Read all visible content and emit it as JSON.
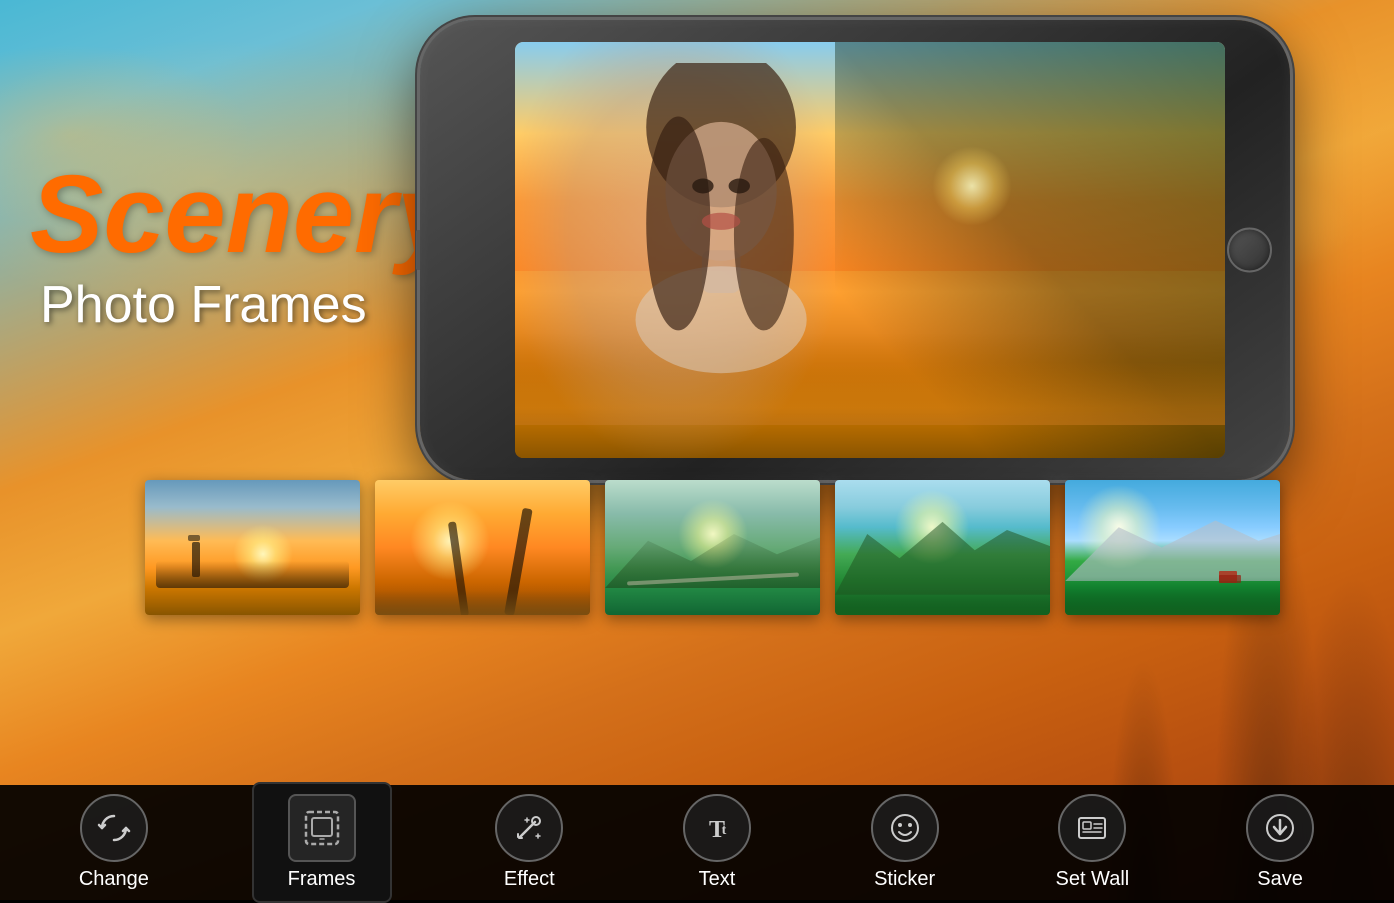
{
  "app": {
    "title": "Scenery Photo Frames"
  },
  "title": {
    "scenery": "Scenery",
    "subtitle": "Photo Frames"
  },
  "thumbnails": [
    {
      "id": 1,
      "label": "Lighthouse Sunset",
      "style": "thumb1"
    },
    {
      "id": 2,
      "label": "Palm Beach Sunset",
      "style": "thumb2"
    },
    {
      "id": 3,
      "label": "Great Wall Mountains",
      "style": "thumb3"
    },
    {
      "id": 4,
      "label": "Green Mountains",
      "style": "thumb4"
    },
    {
      "id": 5,
      "label": "Blue Sky Mountains",
      "style": "thumb5"
    }
  ],
  "toolbar": {
    "items": [
      {
        "id": "change",
        "label": "Change",
        "icon": "↺",
        "active": false
      },
      {
        "id": "frames",
        "label": "Frames",
        "icon": "⬜",
        "active": true
      },
      {
        "id": "effect",
        "label": "Effect",
        "icon": "✨",
        "active": false
      },
      {
        "id": "text",
        "label": "Text",
        "icon": "Tt",
        "active": false
      },
      {
        "id": "sticker",
        "label": "Sticker",
        "icon": "☺",
        "active": false
      },
      {
        "id": "set-wall",
        "label": "Set Wall",
        "icon": "🖼",
        "active": false
      },
      {
        "id": "save",
        "label": "Save",
        "icon": "⬇",
        "active": false
      }
    ]
  }
}
